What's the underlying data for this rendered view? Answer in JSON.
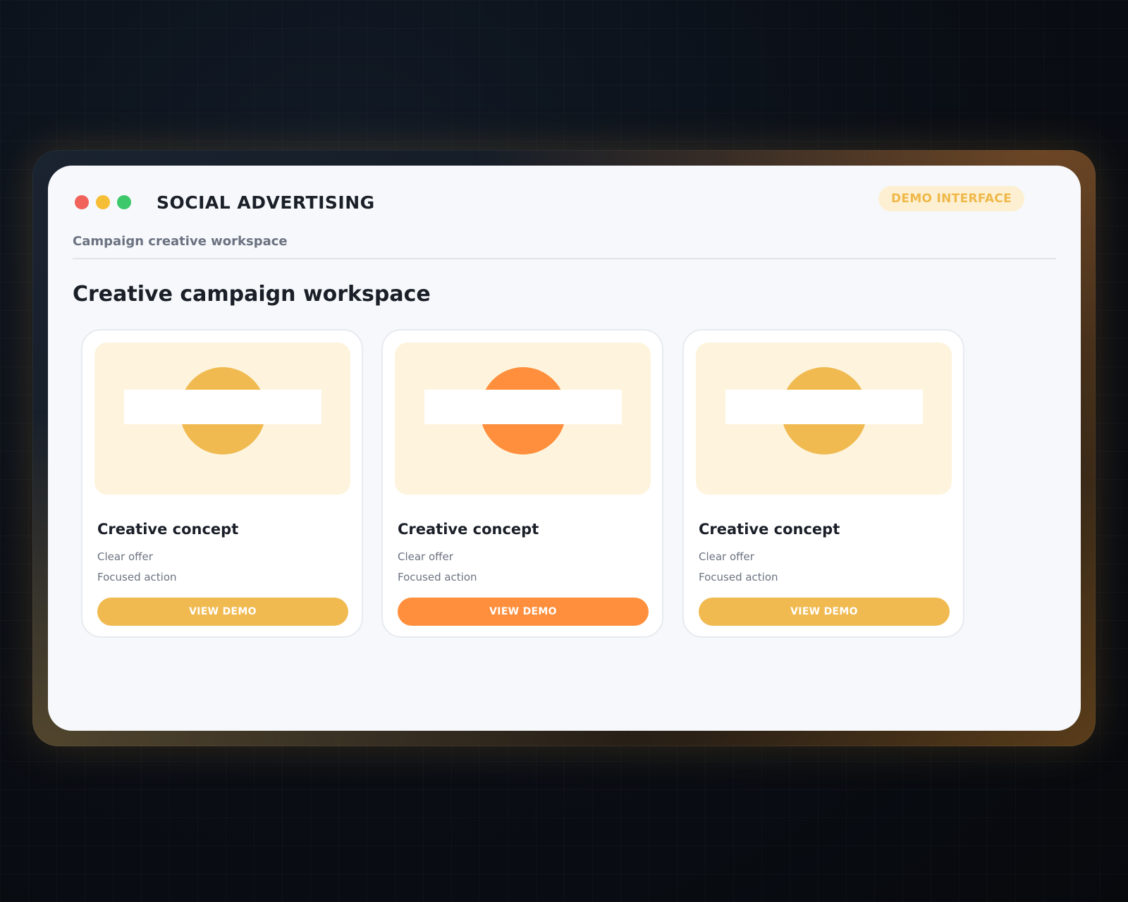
{
  "window": {
    "title": "SOCIAL ADVERTISING",
    "badge": "DEMO INTERFACE",
    "controls": [
      {
        "name": "close",
        "color": "#f0625a"
      },
      {
        "name": "minimize",
        "color": "#f6be35"
      },
      {
        "name": "maximize",
        "color": "#3dc96b"
      }
    ]
  },
  "header": {
    "subtitle": "Campaign creative workspace",
    "heading": "Creative campaign workspace"
  },
  "cards": [
    {
      "title": "Creative concept",
      "line1": "Clear offer",
      "line2": "Focused action",
      "button": "VIEW DEMO",
      "accent": "#f0ba50"
    },
    {
      "title": "Creative concept",
      "line1": "Clear offer",
      "line2": "Focused action",
      "button": "VIEW DEMO",
      "accent": "#ff8f3c"
    },
    {
      "title": "Creative concept",
      "line1": "Clear offer",
      "line2": "Focused action",
      "button": "VIEW DEMO",
      "accent": "#f0ba50"
    }
  ],
  "colors": {
    "thumb_background": "#fef4dd",
    "window_background": "#f6f8fb",
    "badge_text": "#efb849",
    "badge_background": "#fdf0d2"
  }
}
